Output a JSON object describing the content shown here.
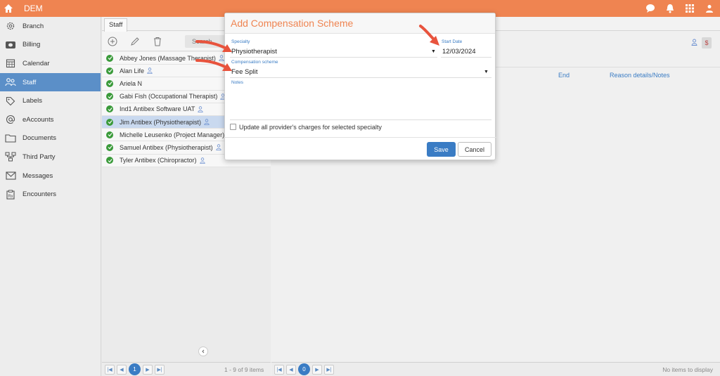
{
  "app": {
    "title": "DEM"
  },
  "topbar": {
    "icons": [
      "home-icon",
      "chat-icon",
      "bell-icon",
      "apps-grid-icon",
      "user-icon"
    ]
  },
  "sidebar": {
    "items": [
      {
        "label": "Branch",
        "icon": "gear-icon"
      },
      {
        "label": "Billing",
        "icon": "money-icon"
      },
      {
        "label": "Calendar",
        "icon": "calendar-icon"
      },
      {
        "label": "Staff",
        "icon": "staff-icon",
        "active": true
      },
      {
        "label": "Labels",
        "icon": "tag-icon"
      },
      {
        "label": "eAccounts",
        "icon": "at-icon"
      },
      {
        "label": "Documents",
        "icon": "folder-icon"
      },
      {
        "label": "Third Party",
        "icon": "network-icon"
      },
      {
        "label": "Messages",
        "icon": "envelope-icon"
      },
      {
        "label": "Encounters",
        "icon": "clipboard-icon"
      }
    ]
  },
  "tabs": {
    "staff": "Staff"
  },
  "staff_search_placeholder": "Search",
  "staff": [
    {
      "name": "Abbey Jones (Massage Therapist)",
      "person_icon": true
    },
    {
      "name": "Alan Life",
      "person_icon": true
    },
    {
      "name": "Ariela N",
      "person_icon": false
    },
    {
      "name": "Gabi Fish (Occupational Therapist)",
      "person_icon": true
    },
    {
      "name": "Ind1 Antibex Software UAT",
      "person_icon": true
    },
    {
      "name": "Jim Antibex (Physiotherapist)",
      "person_icon": true,
      "selected": true
    },
    {
      "name": "Michelle Leusenko (Project Manager)",
      "person_icon": false
    },
    {
      "name": "Samuel Antibex (Physiotherapist)",
      "person_icon": true
    },
    {
      "name": "Tyler Antibex (Chiropractor)",
      "person_icon": true
    }
  ],
  "right_table": {
    "columns": [
      "End",
      "Reason details/Notes"
    ],
    "dollar": "$"
  },
  "pager_left": {
    "page": "1",
    "info": "1 - 9 of 9 items"
  },
  "pager_right": {
    "page": "0",
    "info": "No items to display"
  },
  "modal": {
    "title": "Add Compensation Scheme",
    "specialty_label": "Specialty",
    "specialty_value": "Physiotherapist",
    "start_date_label": "Start Date",
    "start_date_value": "12/03/2024",
    "scheme_label": "Compensation scheme",
    "scheme_value": "Fee Split",
    "notes_label": "Notes",
    "notes_value": "",
    "checkbox_label": "Update all provider's charges for selected specialty",
    "save": "Save",
    "cancel": "Cancel"
  },
  "colors": {
    "brand": "#ef8451",
    "accent": "#3a7cc4",
    "active_nav": "#5b8fc8",
    "annotation_arrow": "#e8533d"
  }
}
